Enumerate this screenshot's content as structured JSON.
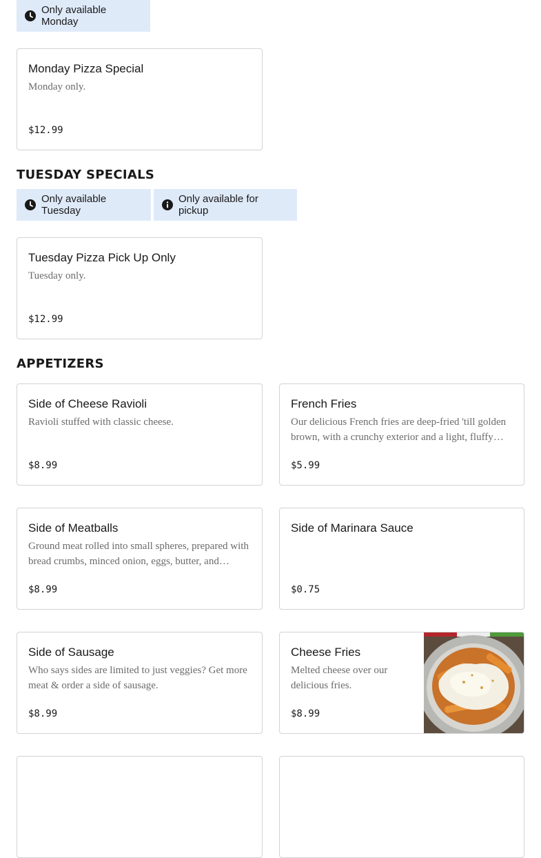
{
  "monday": {
    "badges": [
      {
        "label": "Only available Monday",
        "icon": "clock-icon"
      }
    ],
    "items": [
      {
        "name": "Monday Pizza Special",
        "description": "Monday only.",
        "price": "$12.99"
      }
    ]
  },
  "tuesday": {
    "title": "TUESDAY SPECIALS",
    "badges": [
      {
        "label": "Only available Tuesday",
        "icon": "clock-icon"
      },
      {
        "label": "Only available for pickup",
        "icon": "info-icon"
      }
    ],
    "items": [
      {
        "name": "Tuesday Pizza Pick Up Only",
        "description": "Tuesday only.",
        "price": "$12.99"
      }
    ]
  },
  "appetizers": {
    "title": "APPETIZERS",
    "items": [
      {
        "name": "Side of Cheese Ravioli",
        "description": "Ravioli stuffed with classic cheese.",
        "price": "$8.99"
      },
      {
        "name": "French Fries",
        "description": "Our delicious French fries are deep-fried 'till golden brown, with a crunchy exterior and a light, fluffy interior.",
        "price": "$5.99"
      },
      {
        "name": "Side of Meatballs",
        "description": "Ground meat rolled into small spheres, prepared with bread crumbs, minced onion, eggs, butter, and seasoning.",
        "price": "$8.99"
      },
      {
        "name": "Side of Marinara Sauce",
        "description": "",
        "price": "$0.75"
      },
      {
        "name": "Side of Sausage",
        "description": "Who says sides are limited to just veggies? Get more meat & order a side of sausage.",
        "price": "$8.99"
      },
      {
        "name": "Cheese Fries",
        "description": "Melted cheese over our delicious fries.",
        "price": "$8.99",
        "image": "cheese-fries-photo"
      }
    ]
  },
  "colors": {
    "badge_bg": "#dfeaf9",
    "text": "#191919",
    "muted": "#6b6b6b",
    "border": "#d3d3d3"
  }
}
